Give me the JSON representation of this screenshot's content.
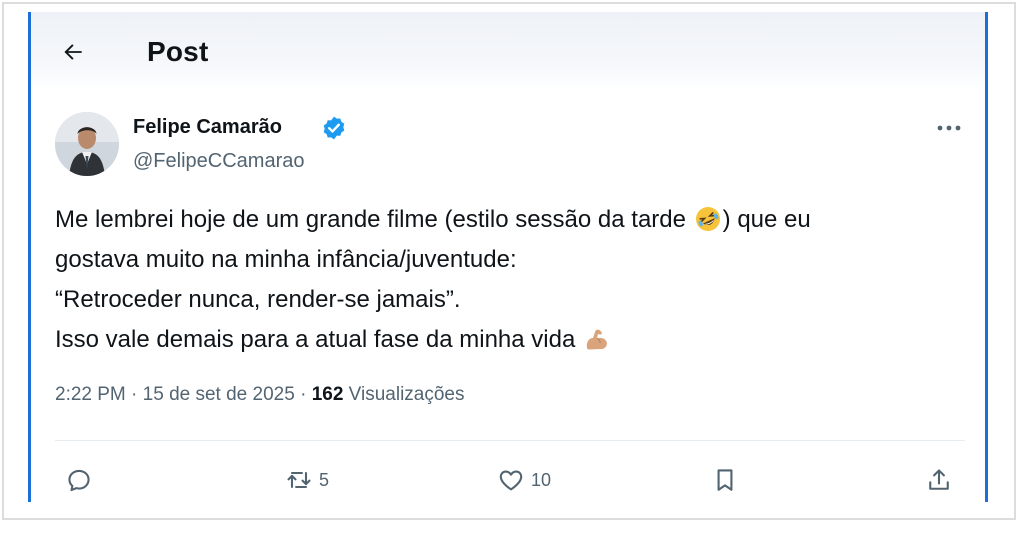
{
  "header": {
    "title": "Post",
    "back_icon": "arrow-left-icon"
  },
  "author": {
    "name": "Felipe Camarão",
    "handle": "@FelipeCCamarao",
    "verified_icon": "verified-badge-icon"
  },
  "post": {
    "lines": [
      "Me lembrei hoje de um grande filme (estilo sessão da tarde ",
      ") que eu",
      "gostava muito na minha infância/juventude:",
      "“Retroceder nunca, render-se jamais”.",
      "Isso vale demais para a atual fase da minha vida "
    ],
    "emojis": [
      "rolling-laughing-emoji",
      "flexed-biceps-emoji"
    ]
  },
  "meta": {
    "time": "2:22 PM",
    "separator": " · ",
    "date": "15 de set de 2025",
    "views_count": "162",
    "views_label": " Visualizações"
  },
  "actions": {
    "reply_count": "",
    "repost_count": "5",
    "like_count": "10"
  },
  "colors": {
    "accent": "#1d9bf0",
    "frame_border": "#1d6fd8",
    "secondary_text": "#536471"
  }
}
